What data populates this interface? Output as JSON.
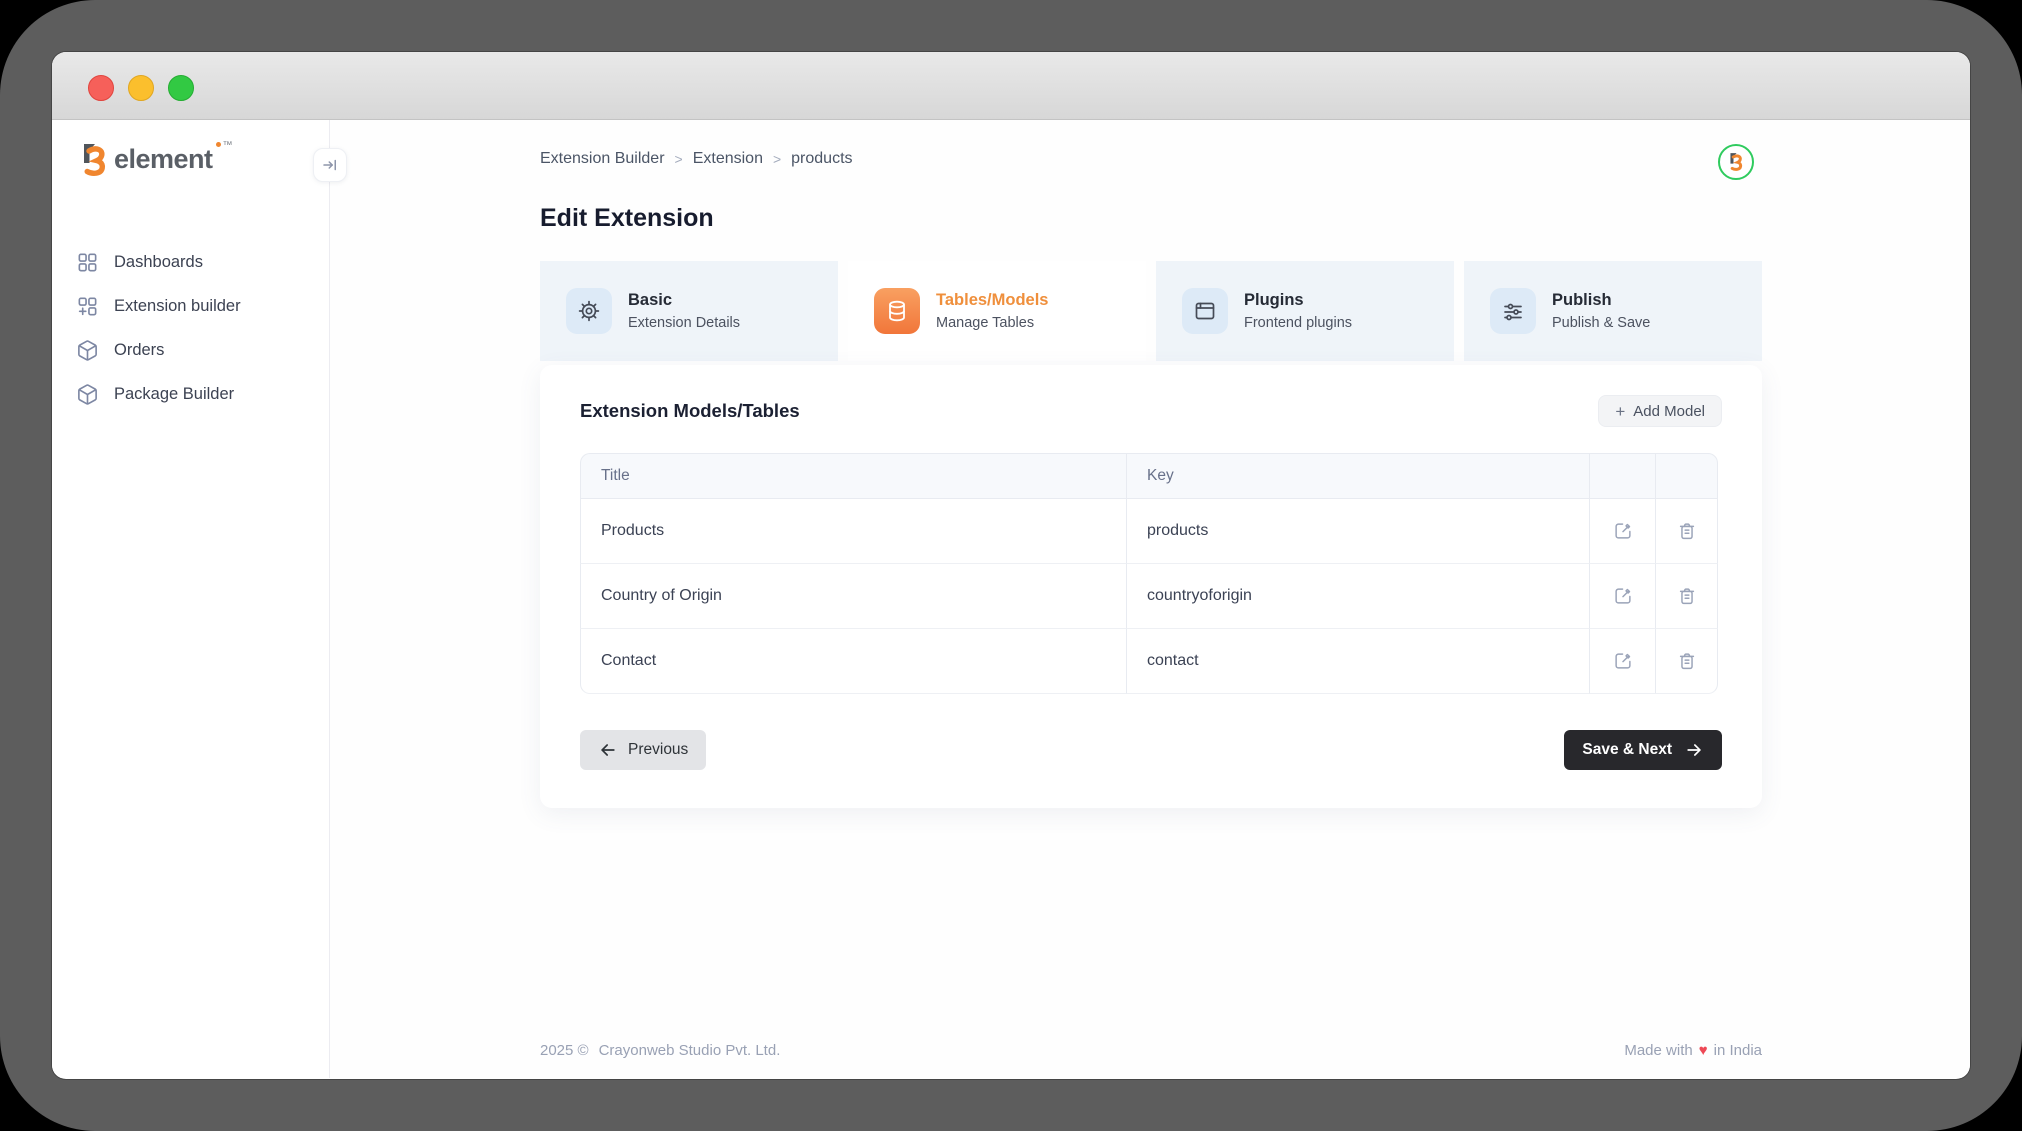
{
  "window": {
    "controls": [
      {
        "name": "close",
        "color": "#f6605a"
      },
      {
        "name": "minimize",
        "color": "#fbbf2d"
      },
      {
        "name": "maximize",
        "color": "#32c943"
      }
    ]
  },
  "brand": {
    "name": "element",
    "tm": "™",
    "accent_color": "#f0862f"
  },
  "sidebar": {
    "items": [
      {
        "label": "Dashboards",
        "icon": "dashboard-grid-icon"
      },
      {
        "label": "Extension builder",
        "icon": "extension-grid-plus-icon"
      },
      {
        "label": "Orders",
        "icon": "package-box-icon"
      },
      {
        "label": "Package Builder",
        "icon": "package-box-icon"
      }
    ],
    "collapse_icon": "arrow-to-bar-icon"
  },
  "breadcrumb": {
    "items": [
      "Extension Builder",
      "Extension",
      "products"
    ],
    "separator": ">"
  },
  "page": {
    "title": "Edit Extension"
  },
  "header": {
    "avatar_icon": "brand-logo",
    "avatar_ring_color": "#2fcb5e"
  },
  "tabs": [
    {
      "title": "Basic",
      "subtitle": "Extension Details",
      "icon": "gear-icon",
      "active": false
    },
    {
      "title": "Tables/Models",
      "subtitle": "Manage Tables",
      "icon": "database-icon",
      "active": true
    },
    {
      "title": "Plugins",
      "subtitle": "Frontend plugins",
      "icon": "browser-window-icon",
      "active": false
    },
    {
      "title": "Publish",
      "subtitle": "Publish & Save",
      "icon": "sliders-icon",
      "active": false
    }
  ],
  "panel": {
    "heading": "Extension Models/Tables",
    "add_button_plus": "+",
    "add_button_label": "Add Model"
  },
  "table": {
    "columns": [
      "Title",
      "Key"
    ],
    "row_actions": [
      "edit",
      "delete"
    ],
    "rows": [
      {
        "title": "Products",
        "key": "products"
      },
      {
        "title": "Country of Origin",
        "key": "countryoforigin"
      },
      {
        "title": "Contact",
        "key": "contact"
      }
    ]
  },
  "actions": {
    "previous": "Previous",
    "save_next": "Save & Next"
  },
  "footer": {
    "copyright": "2025 ©",
    "company": "Crayonweb Studio Pvt. Ltd.",
    "made_with": "Made with",
    "heart": "♥",
    "location": "in India",
    "heart_color": "#ee4956"
  },
  "colors": {
    "active_tab_orange": "#ef8f3c",
    "tab_icon_orange": "#f1763a",
    "inactive_tab_bg": "#eff4f9"
  }
}
